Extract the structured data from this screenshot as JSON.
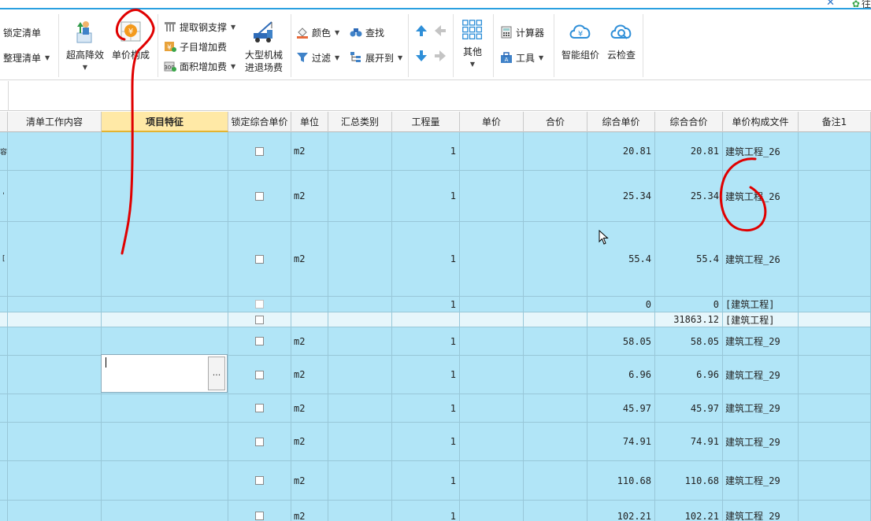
{
  "window": {
    "close_glyph": "✕",
    "extra_label": "往"
  },
  "ribbon": {
    "lock_list": "锁定清单",
    "tidy_list": "整理清单",
    "super_high_reduce": "超高降效",
    "unit_price_composition": "单价构成",
    "extract_steel": "提取钢支撑",
    "sub_item_add_fee": "子目增加费",
    "area_add_fee": "面积增加费",
    "large_machine": "大型机械",
    "enter_exit_site": "进退场费",
    "color": "颜色",
    "find": "查找",
    "filter": "过滤",
    "expand_to": "展开到",
    "other": "其他",
    "calculator": "计算器",
    "tools": "工具",
    "smart_price": "智能组价",
    "cloud_check": "云检查"
  },
  "table": {
    "headers": [
      "清单工作内容",
      "项目特征",
      "锁定综合单价",
      "单位",
      "汇总类别",
      "工程量",
      "单价",
      "合价",
      "综合单价",
      "综合合价",
      "单价构成文件",
      "备注1"
    ],
    "rows": [
      {
        "mark": "容",
        "unit": "m2",
        "qty": "1",
        "comp_price": "20.81",
        "comp_total": "20.81",
        "file": "建筑工程_26"
      },
      {
        "mark": "'",
        "unit": "m2",
        "qty": "1",
        "comp_price": "25.34",
        "comp_total": "25.34",
        "file": "建筑工程_26"
      },
      {
        "mark": "[",
        "unit": "m2",
        "qty": "1",
        "comp_price": "55.4",
        "comp_total": "55.4",
        "file": "建筑工程_26"
      },
      {
        "mark": "",
        "unit": "",
        "qty": "1",
        "comp_price": "0",
        "comp_total": "0",
        "file": "[建筑工程]"
      },
      {
        "mark": "",
        "unit": "",
        "qty": "",
        "comp_price": "",
        "comp_total": "31863.12",
        "file": "[建筑工程]"
      },
      {
        "mark": "",
        "unit": "m2",
        "qty": "1",
        "comp_price": "58.05",
        "comp_total": "58.05",
        "file": "建筑工程_29"
      },
      {
        "mark": "",
        "unit": "m2",
        "qty": "1",
        "comp_price": "6.96",
        "comp_total": "6.96",
        "file": "建筑工程_29"
      },
      {
        "mark": "",
        "unit": "m2",
        "qty": "1",
        "comp_price": "45.97",
        "comp_total": "45.97",
        "file": "建筑工程_29"
      },
      {
        "mark": "",
        "unit": "m2",
        "qty": "1",
        "comp_price": "74.91",
        "comp_total": "74.91",
        "file": "建筑工程_29"
      },
      {
        "mark": "",
        "unit": "m2",
        "qty": "1",
        "comp_price": "110.68",
        "comp_total": "110.68",
        "file": "建筑工程_29"
      },
      {
        "mark": "",
        "unit": "m2",
        "qty": "1",
        "comp_price": "102.21",
        "comp_total": "102.21",
        "file": "建筑工程_29"
      }
    ]
  },
  "editor": {
    "button_label": "..."
  },
  "icons": {
    "lock": "lock-icon",
    "super_high": "person-arrow-icon",
    "unit_price": "coin-grid-icon",
    "steel": "steel-support-icon",
    "sub_item": "fee-plus-icon",
    "area": "area-fee-icon",
    "machine": "crane-truck-icon",
    "color": "paint-bucket-icon",
    "find": "binoculars-icon",
    "filter": "funnel-icon",
    "expand": "tree-icon",
    "up": "arrow-up-icon",
    "left": "arrow-left-icon",
    "down": "arrow-down-icon",
    "right": "arrow-right-icon",
    "other": "grid-icon",
    "calculator": "calculator-icon",
    "tools": "toolbox-icon",
    "smart": "cloud-yen-icon",
    "cloud": "cloud-search-icon"
  },
  "colors": {
    "row_bg": "#b1e5f7",
    "header_active": "#ffe9a6",
    "accent": "#2aa0e0",
    "annotation": "#e00000"
  }
}
